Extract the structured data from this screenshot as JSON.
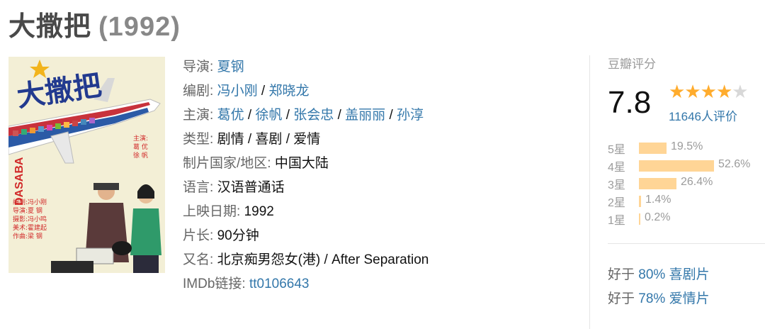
{
  "header": {
    "title": "大撒把",
    "year": "(1992)"
  },
  "poster": {
    "title_text": "大撒把",
    "big_letters": "DASABA",
    "icon": "film-poster"
  },
  "info": {
    "director_label": "导演",
    "director": "夏钢",
    "writer_label": "编剧",
    "writers": [
      "冯小刚",
      "郑晓龙"
    ],
    "cast_label": "主演",
    "cast": [
      "葛优",
      "徐帆",
      "张会忠",
      "盖丽丽",
      "孙淳"
    ],
    "genre_label": "类型",
    "genres": "剧情 / 喜剧 / 爱情",
    "region_label": "制片国家/地区",
    "region": "中国大陆",
    "language_label": "语言",
    "language": "汉语普通话",
    "release_label": "上映日期",
    "release": "1992",
    "runtime_label": "片长",
    "runtime": "90分钟",
    "aka_label": "又名",
    "aka": "北京痴男怨女(港) / After Separation",
    "imdb_label": "IMDb链接",
    "imdb": "tt0106643"
  },
  "rating": {
    "label": "豆瓣评分",
    "score": "7.8",
    "stars_filled": 4,
    "stars_total": 5,
    "star_color": "#ffac2d",
    "count_text": "11646人评价",
    "distribution": [
      {
        "label": "5星",
        "pct": "19.5%",
        "value": 19.5
      },
      {
        "label": "4星",
        "pct": "52.6%",
        "value": 52.6
      },
      {
        "label": "3星",
        "pct": "26.4%",
        "value": 26.4
      },
      {
        "label": "2星",
        "pct": "1.4%",
        "value": 1.4
      },
      {
        "label": "1星",
        "pct": "0.2%",
        "value": 0.2
      }
    ]
  },
  "better_than": [
    {
      "prefix": "好于",
      "pct": "80%",
      "genre": "喜剧片"
    },
    {
      "prefix": "好于",
      "pct": "78%",
      "genre": "爱情片"
    }
  ]
}
